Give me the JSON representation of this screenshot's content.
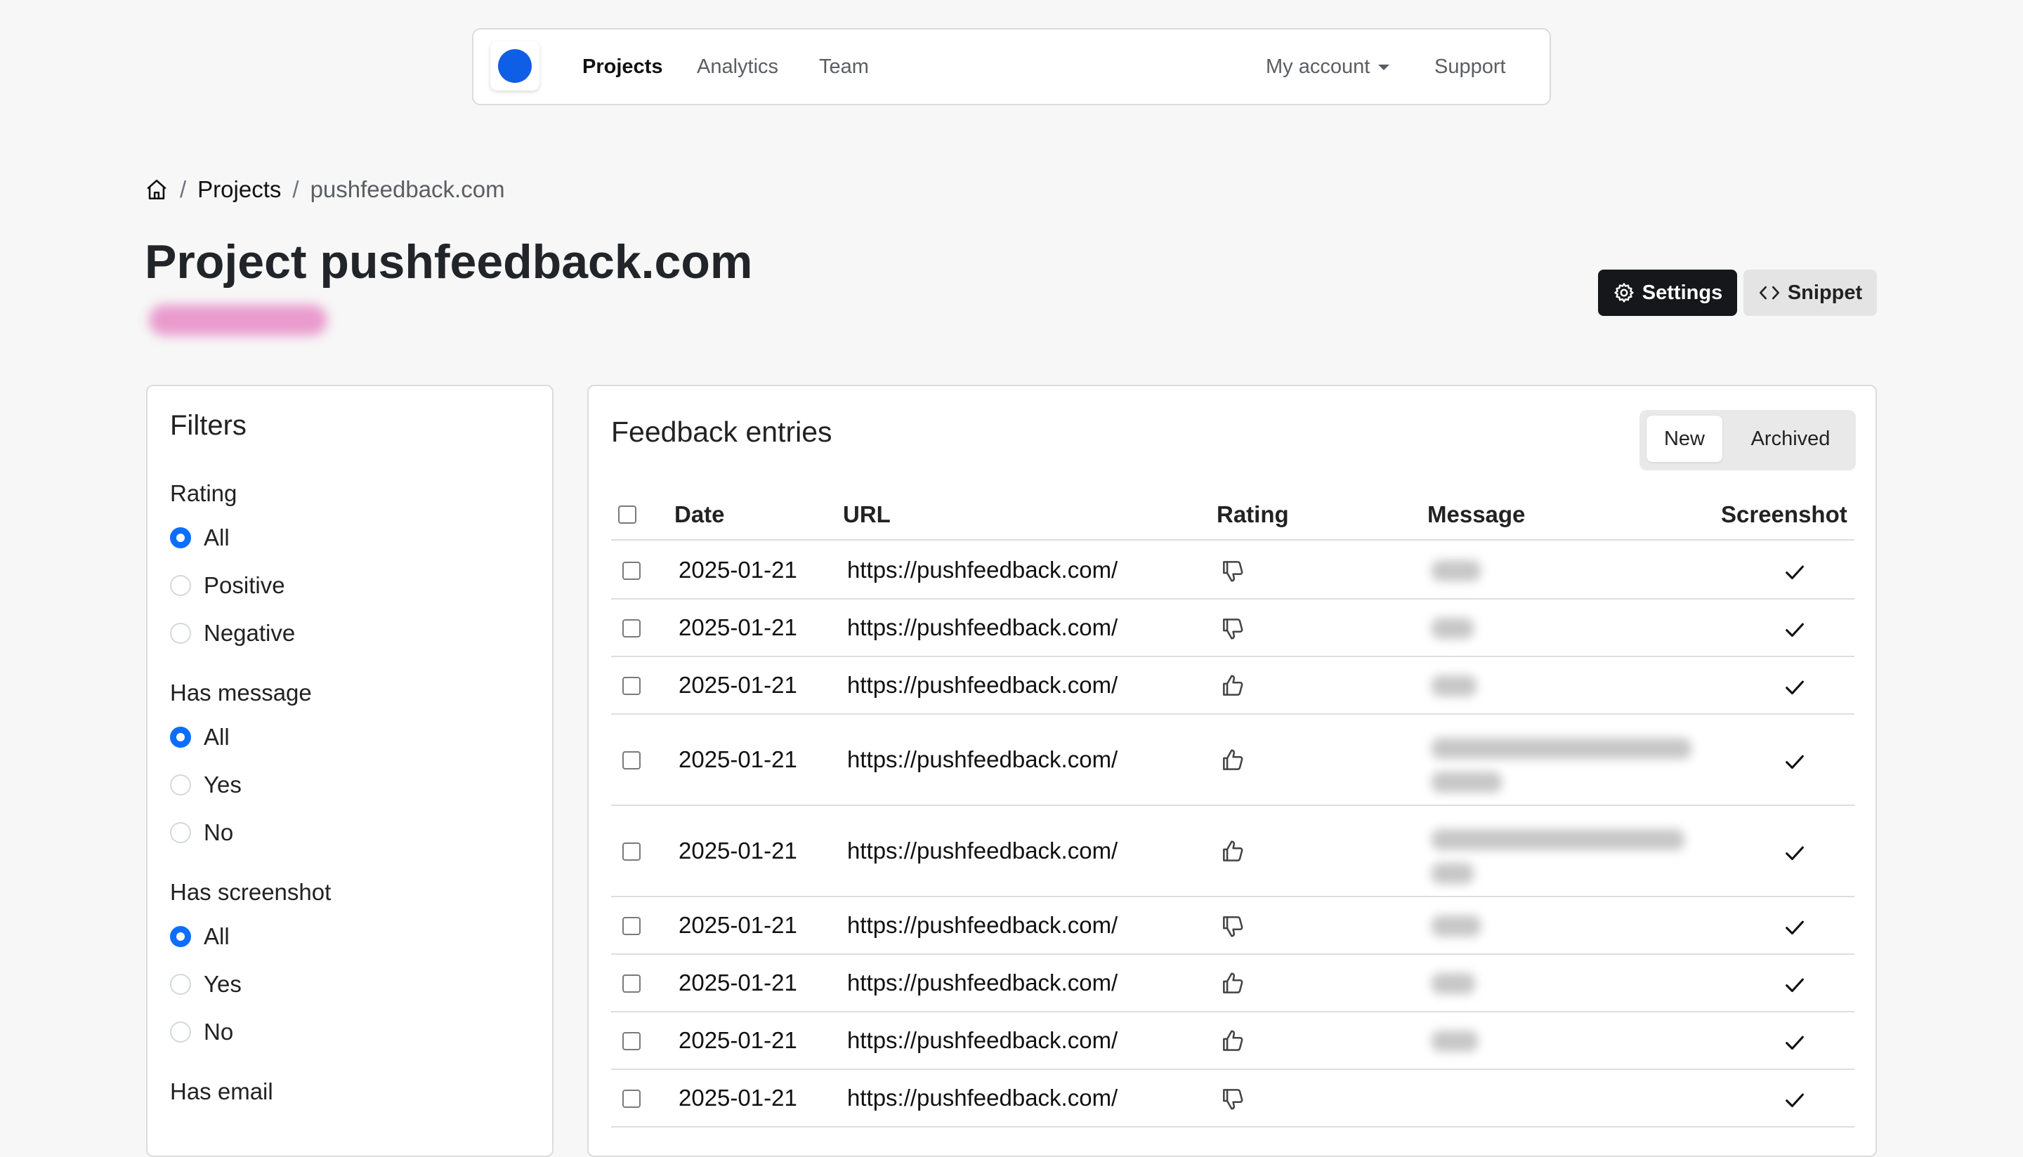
{
  "nav": {
    "links": [
      "Projects",
      "Analytics",
      "Team"
    ],
    "account_label": "My account",
    "support_label": "Support"
  },
  "breadcrumb": {
    "projects": "Projects",
    "separator": "/",
    "current": "pushfeedback.com"
  },
  "page": {
    "title": "Project pushfeedback.com"
  },
  "actions": {
    "settings_label": "Settings",
    "snippet_label": "Snippet"
  },
  "filters": {
    "title": "Filters",
    "groups": [
      {
        "title": "Rating",
        "options": [
          "All",
          "Positive",
          "Negative"
        ],
        "selected": "All"
      },
      {
        "title": "Has message",
        "options": [
          "All",
          "Yes",
          "No"
        ],
        "selected": "All"
      },
      {
        "title": "Has screenshot",
        "options": [
          "All",
          "Yes",
          "No"
        ],
        "selected": "All"
      },
      {
        "title": "Has email",
        "options": [],
        "selected": ""
      }
    ]
  },
  "feedback": {
    "title": "Feedback entries",
    "tabs": {
      "new": "New",
      "archived": "Archived",
      "active": "New"
    },
    "columns": {
      "date": "Date",
      "url": "URL",
      "rating": "Rating",
      "message": "Message",
      "screenshot": "Screenshot"
    },
    "rows": [
      {
        "date": "2025-01-21",
        "url": "https://pushfeedback.com/",
        "rating": "negative",
        "has_screenshot": true
      },
      {
        "date": "2025-01-21",
        "url": "https://pushfeedback.com/",
        "rating": "negative",
        "has_screenshot": true
      },
      {
        "date": "2025-01-21",
        "url": "https://pushfeedback.com/",
        "rating": "positive",
        "has_screenshot": true
      },
      {
        "date": "2025-01-21",
        "url": "https://pushfeedback.com/",
        "rating": "positive",
        "has_screenshot": true
      },
      {
        "date": "2025-01-21",
        "url": "https://pushfeedback.com/",
        "rating": "positive",
        "has_screenshot": true
      },
      {
        "date": "2025-01-21",
        "url": "https://pushfeedback.com/",
        "rating": "negative",
        "has_screenshot": true
      },
      {
        "date": "2025-01-21",
        "url": "https://pushfeedback.com/",
        "rating": "positive",
        "has_screenshot": true
      },
      {
        "date": "2025-01-21",
        "url": "https://pushfeedback.com/",
        "rating": "positive",
        "has_screenshot": true
      },
      {
        "date": "2025-01-21",
        "url": "https://pushfeedback.com/",
        "rating": "negative",
        "has_screenshot": true
      }
    ]
  },
  "colors": {
    "accent": "#0d6efd",
    "logo": "#0f5ee6",
    "settings_button": "#15171a"
  },
  "icons": {
    "home": "home-icon",
    "settings": "gear-icon",
    "snippet": "code-icon",
    "positive": "thumbs-up-icon",
    "negative": "thumbs-down-icon",
    "screenshot": "check-icon"
  }
}
